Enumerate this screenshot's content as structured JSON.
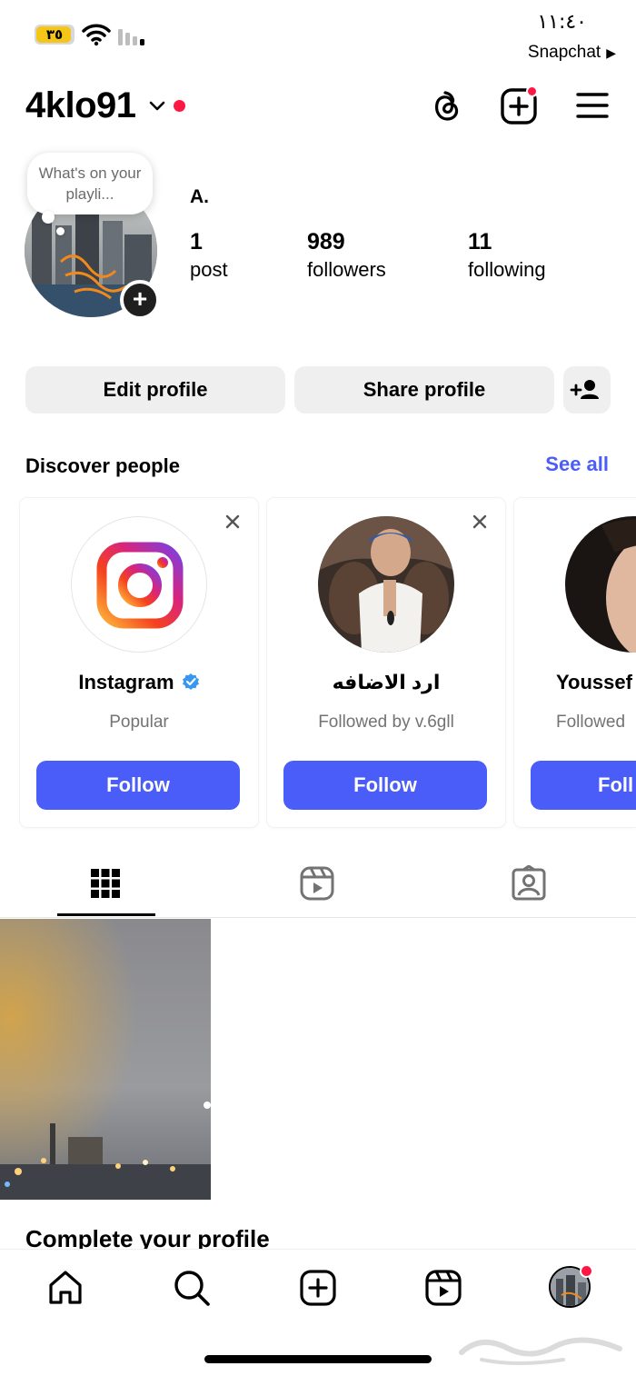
{
  "status_bar": {
    "battery": "٣٥",
    "time": "١١:٤٠",
    "back_app": "Snapchat",
    "back_arrow": "▶"
  },
  "header": {
    "username": "4klo91"
  },
  "profile": {
    "note": "What's on your playli...",
    "display_name": "A.",
    "stats": [
      {
        "value": "1",
        "label": "post"
      },
      {
        "value": "989",
        "label": "followers"
      },
      {
        "value": "11",
        "label": "following"
      }
    ],
    "add_glyph": "+"
  },
  "actions": {
    "edit_profile": "Edit profile",
    "share_profile": "Share profile"
  },
  "discover": {
    "title": "Discover people",
    "see_all": "See all",
    "cards": [
      {
        "name": "Instagram",
        "subtitle": "Popular",
        "follow": "Follow",
        "verified": true
      },
      {
        "name": "ارد الاضافه",
        "subtitle": "Followed by v.6gll",
        "follow": "Follow",
        "verified": false
      },
      {
        "name": "Youssef",
        "subtitle": "Followed",
        "follow": "Foll",
        "verified": false
      }
    ]
  },
  "tabs": [
    "posts-grid",
    "reels",
    "tagged"
  ],
  "complete_profile": "Complete your profile",
  "bottom_nav": [
    "home",
    "search",
    "create",
    "reels",
    "profile"
  ],
  "colors": {
    "accent": "#4a5df8",
    "notification": "#ff1744",
    "button_gray": "#efefef",
    "verified": "#3897f0"
  }
}
